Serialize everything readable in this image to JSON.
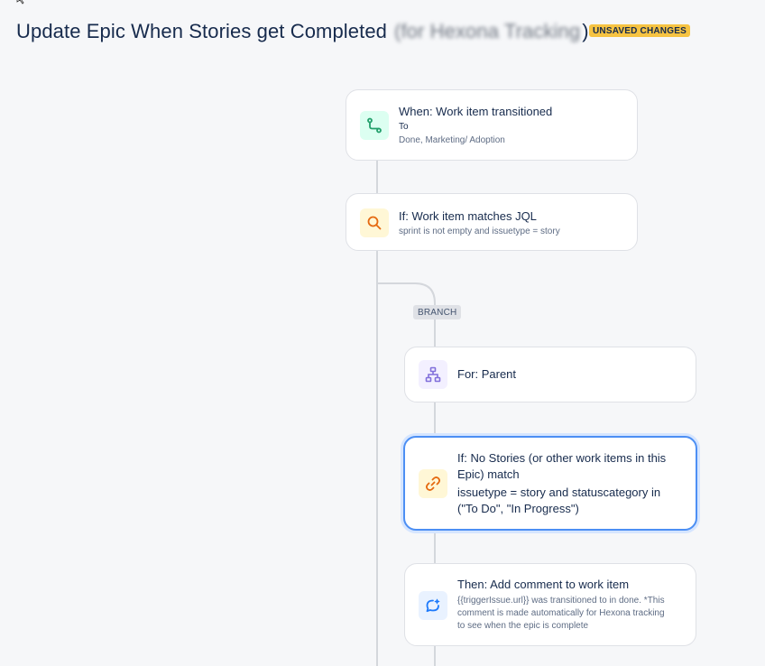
{
  "header": {
    "title": "Update Epic When Stories get Completed",
    "title_blurred": "(for Hexona Tracking",
    "title_close": ")",
    "badge": "UNSAVED CHANGES"
  },
  "flow": {
    "trigger": {
      "icon": "transition-icon",
      "title": "When: Work item transitioned",
      "line": "To",
      "sub": "Done, Marketing/ Adoption"
    },
    "condition": {
      "icon": "search-icon",
      "title": "If: Work item matches JQL",
      "sub": "sprint is not empty and issuetype = story"
    },
    "branch_label": "BRANCH",
    "branch_for": {
      "icon": "hierarchy-icon",
      "title": "For: Parent"
    },
    "branch_condition": {
      "icon": "link-icon",
      "title": "If: No Stories (or other work items in this Epic) match",
      "sub": "issuetype = story and statuscategory in (\"To Do\", \"In Progress\")"
    },
    "action": {
      "icon": "comment-icon",
      "title": "Then: Add comment to work item",
      "sub": "{{triggerIssue.url}} was transitioned to in done. *This comment is made automatically for Hexona tracking to see when the epic is complete"
    }
  },
  "colors": {
    "trigger_icon_bg": "#dcfff1",
    "trigger_icon": "#22a06b",
    "condition_icon_bg": "#fff7d6",
    "condition_icon": "#e56910",
    "branch_icon_bg": "#f3f0ff",
    "branch_icon": "#8270db",
    "link_icon_bg": "#fff7d6",
    "comment_icon_bg": "#e9f2ff",
    "comment_icon": "#1d7afc",
    "badge": "#f6c342",
    "selected_border": "#4c8ff4"
  }
}
